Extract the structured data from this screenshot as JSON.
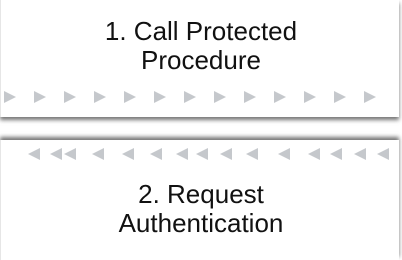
{
  "steps": [
    {
      "line1": "1.  Call Protected",
      "line2": "Procedure",
      "arrow_direction": "right"
    },
    {
      "line1": "2.  Request",
      "line2": "Authentication",
      "arrow_direction": "left"
    }
  ],
  "colors": {
    "arrow": "#c5c8cc",
    "text": "#111111",
    "box": "#ffffff"
  }
}
